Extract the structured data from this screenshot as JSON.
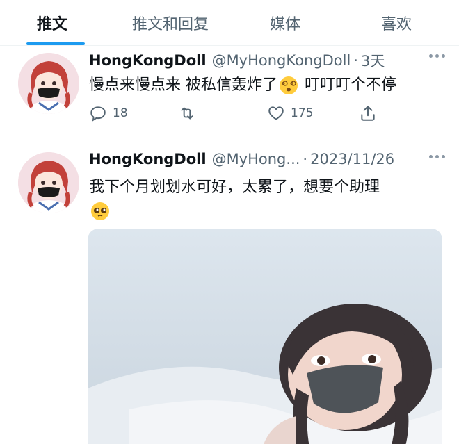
{
  "tabs": [
    {
      "label": "推文",
      "active": true
    },
    {
      "label": "推文和回复",
      "active": false
    },
    {
      "label": "媒体",
      "active": false
    },
    {
      "label": "喜欢",
      "active": false
    }
  ],
  "tweets": [
    {
      "name": "HongKongDoll",
      "handle": "@MyHongKongDoll",
      "separator": "·",
      "time": "3天",
      "text_before": "慢点来慢点来 被私信轰炸了",
      "emoji": "dizzy-face",
      "text_after": " 叮叮叮个不停",
      "replies": "18",
      "likes": "175"
    },
    {
      "name": "HongKongDoll",
      "handle": "@MyHong...",
      "separator": "·",
      "time": "2023/11/26",
      "text": "我下个月划划水可好，太累了，想要个助理",
      "emoji": "pleading-face"
    }
  ],
  "colors": {
    "accent": "#1d9bf0",
    "secondary_text": "#536471",
    "primary_text": "#0f1419"
  }
}
